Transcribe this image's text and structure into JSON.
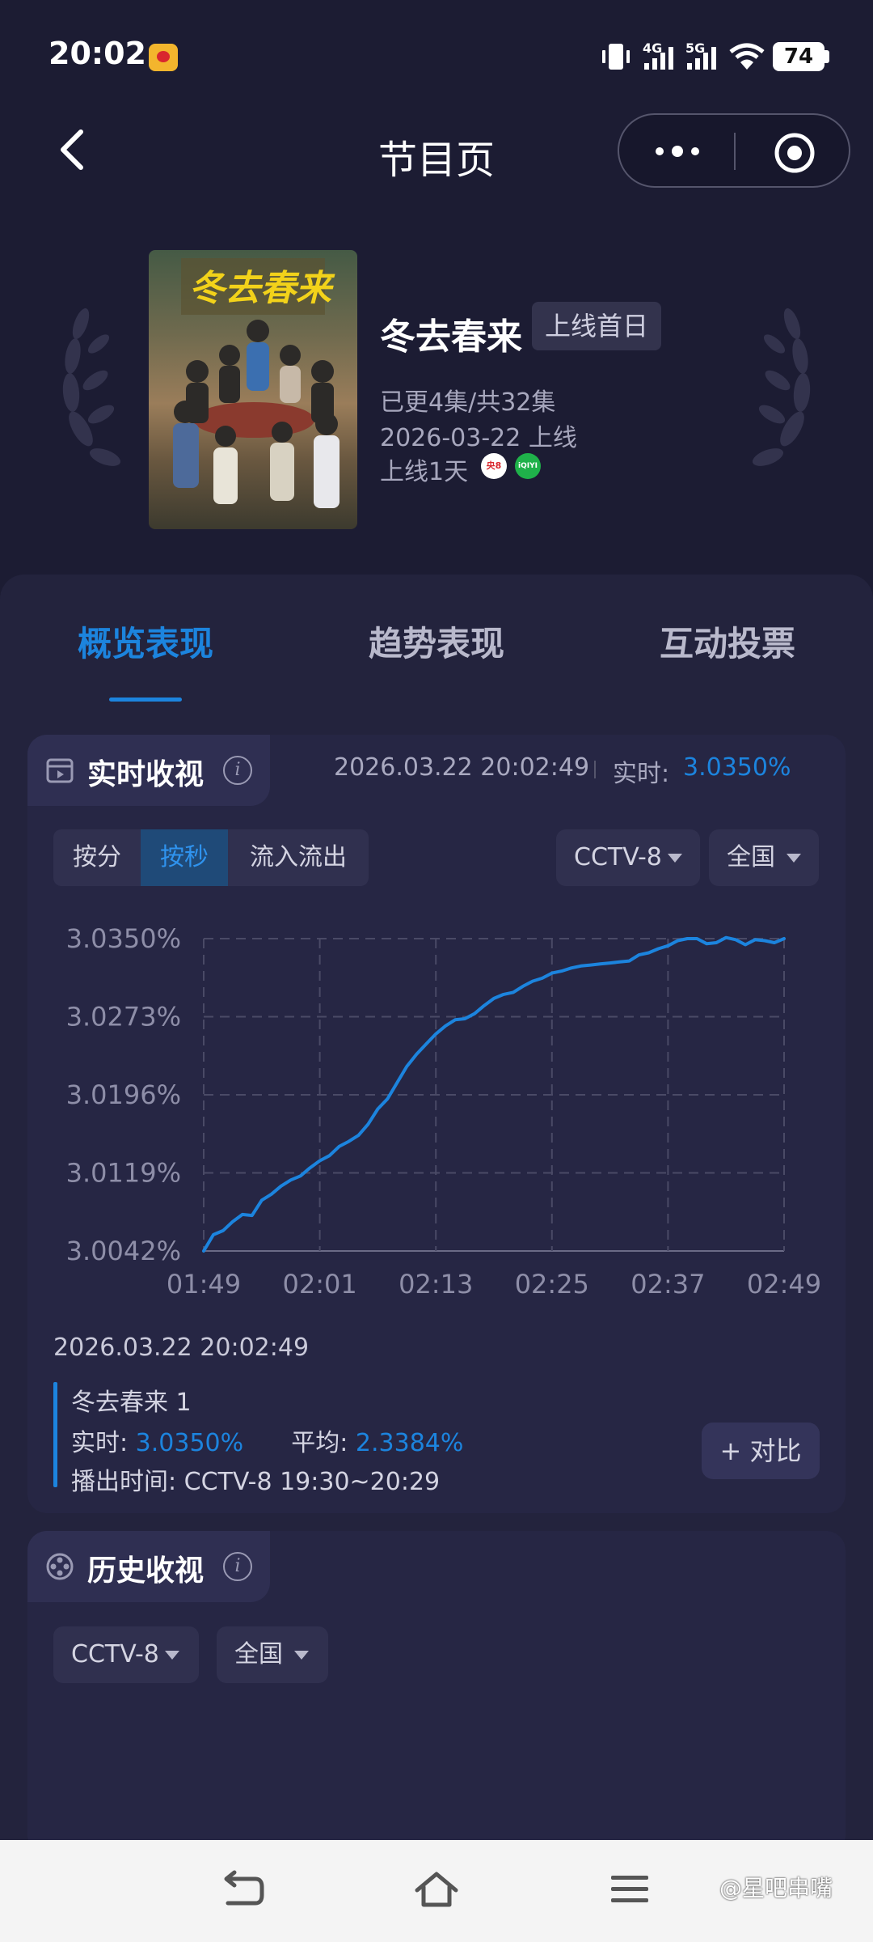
{
  "status_bar": {
    "time": "20:02",
    "signal_1": "4G",
    "signal_2": "5G",
    "battery": "74"
  },
  "header": {
    "title": "节目页"
  },
  "show": {
    "title": "冬去春来",
    "status_badge": "上线首日",
    "episodes": "已更4集/共32集",
    "release": "2026-03-22 上线",
    "days_online": "上线1天",
    "platforms": [
      {
        "name": "央8",
        "color": "#d9272e"
      },
      {
        "name": "iQIYI",
        "color": "#1fb14a"
      }
    ]
  },
  "tabs": [
    {
      "label": "概览表现",
      "active": true
    },
    {
      "label": "趋势表现",
      "active": false
    },
    {
      "label": "互动投票",
      "active": false
    }
  ],
  "realtime": {
    "title": "实时收视",
    "timestamp": "2026.03.22 20:02:49",
    "now_label": "实时:",
    "now_value": "3.0350%",
    "modes": [
      "按分",
      "按秒",
      "流入流出"
    ],
    "active_mode": "按秒",
    "channel": "CCTV-8",
    "region": "全国",
    "footer_timestamp": "2026.03.22 20:02:49",
    "legend": {
      "series_name": "冬去春来 1",
      "now_label": "实时:",
      "now_value": "3.0350%",
      "avg_label": "平均:",
      "avg_value": "2.3384%",
      "airtime_label": "播出时间:",
      "airtime_value": "CCTV-8 19:30~20:29"
    },
    "compare_label": "+ 对比"
  },
  "history": {
    "title": "历史收视",
    "channel": "CCTV-8",
    "region": "全国"
  },
  "watermark": "@星吧串嘴",
  "chart_data": {
    "type": "line",
    "title": "",
    "xlabel": "",
    "ylabel": "",
    "x_ticks": [
      "01:49",
      "02:01",
      "02:13",
      "02:25",
      "02:37",
      "02:49"
    ],
    "y_ticks": [
      "3.0350%",
      "3.0273%",
      "3.0196%",
      "3.0119%",
      "3.0042%"
    ],
    "ylim": [
      3.0042,
      3.035
    ],
    "x_range_seconds": [
      109,
      169
    ],
    "grid": true,
    "color": "#1c84de",
    "series": [
      {
        "x_seconds": [
          109,
          110,
          111,
          112,
          113,
          114,
          115,
          116,
          117,
          118,
          119,
          120,
          121,
          122,
          123,
          124,
          125,
          126,
          127,
          128,
          129,
          130,
          131,
          132,
          133,
          134,
          135,
          136,
          137,
          138,
          139,
          140,
          141,
          142,
          143,
          144,
          145,
          146,
          147,
          148,
          149,
          150,
          151,
          152,
          153,
          154,
          155,
          156,
          157,
          158,
          159,
          160,
          161,
          162,
          163,
          164,
          165,
          166,
          167,
          168,
          169
        ],
        "values": [
          3.0042,
          3.0058,
          3.0062,
          3.0071,
          3.0078,
          3.0077,
          3.0092,
          3.0098,
          3.0106,
          3.0112,
          3.0116,
          3.0124,
          3.0131,
          3.0136,
          3.0145,
          3.015,
          3.0156,
          3.0167,
          3.0182,
          3.0192,
          3.0208,
          3.0224,
          3.0236,
          3.0246,
          3.0256,
          3.0264,
          3.027,
          3.0271,
          3.0276,
          3.0284,
          3.0291,
          3.0295,
          3.0297,
          3.0303,
          3.0308,
          3.0311,
          3.0316,
          3.0318,
          3.0321,
          3.0323,
          3.0324,
          3.0325,
          3.0326,
          3.0327,
          3.0328,
          3.0334,
          3.0336,
          3.034,
          3.0343,
          3.0348,
          3.035,
          3.035,
          3.0345,
          3.0346,
          3.0351,
          3.0349,
          3.0344,
          3.0349,
          3.0348,
          3.0346,
          3.035
        ]
      }
    ]
  }
}
